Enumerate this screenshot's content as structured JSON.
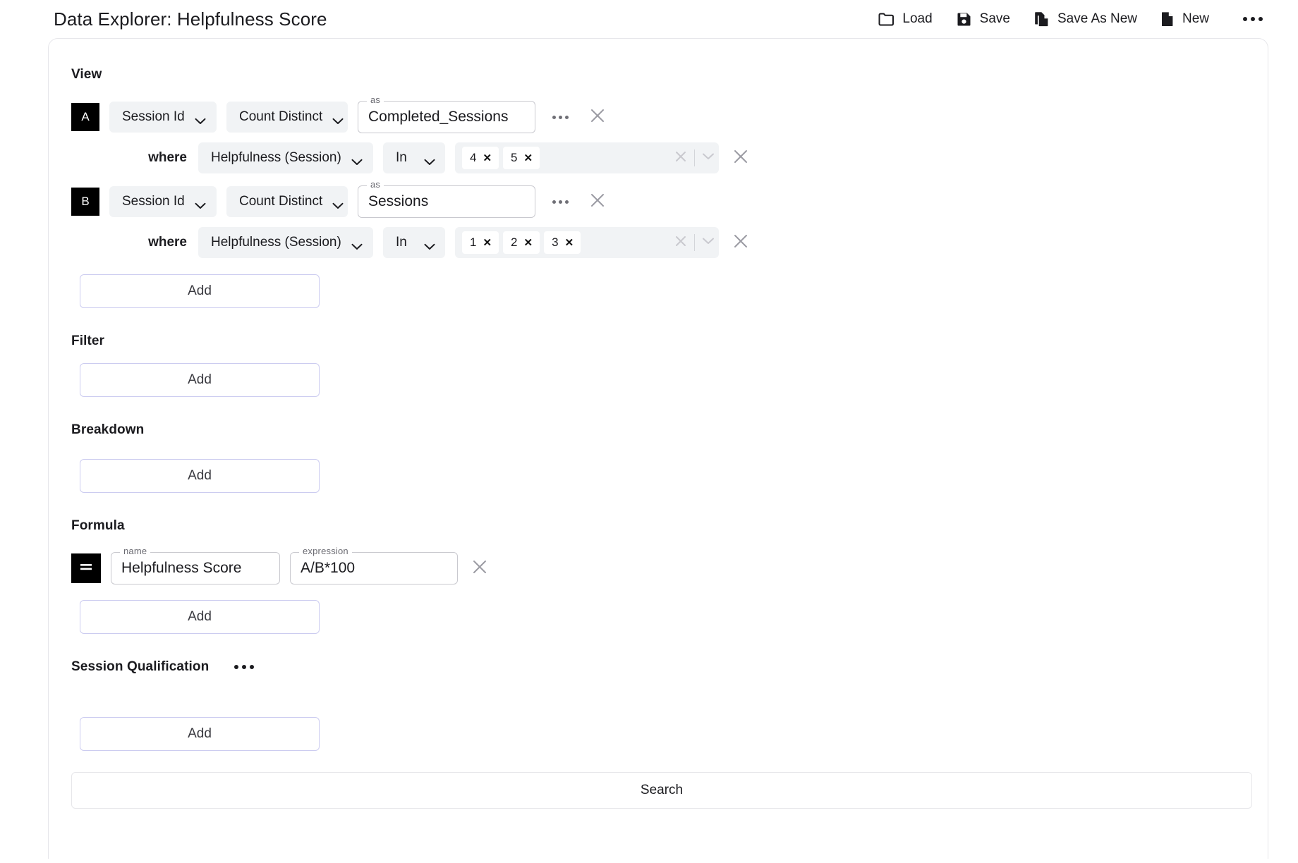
{
  "header": {
    "title": "Data Explorer: Helpfulness Score",
    "actions": [
      {
        "label": "Load",
        "icon": "folder-icon"
      },
      {
        "label": "Save",
        "icon": "floppy-disk-icon"
      },
      {
        "label": "Save As New",
        "icon": "copy-document-icon"
      },
      {
        "label": "New",
        "icon": "document-icon"
      }
    ],
    "overflow_icon": "kebab-menu-icon"
  },
  "sections": {
    "view": {
      "label": "View",
      "rows": [
        {
          "badge": "A",
          "dimension": "Session Id",
          "aggregation": "Count Distinct",
          "alias_legend": "as",
          "alias_value": "Completed_Sessions",
          "where": {
            "keyword": "where",
            "field": "Helpfulness (Session)",
            "operator": "In",
            "values": [
              "4",
              "5"
            ]
          }
        },
        {
          "badge": "B",
          "dimension": "Session Id",
          "aggregation": "Count Distinct",
          "alias_legend": "as",
          "alias_value": "Sessions",
          "where": {
            "keyword": "where",
            "field": "Helpfulness (Session)",
            "operator": "In",
            "values": [
              "1",
              "2",
              "3"
            ]
          }
        }
      ],
      "add_label": "Add"
    },
    "filter": {
      "label": "Filter",
      "add_label": "Add"
    },
    "breakdown": {
      "label": "Breakdown",
      "add_label": "Add"
    },
    "formula": {
      "label": "Formula",
      "badge": "=",
      "name_legend": "name",
      "name_value": "Helpfulness Score",
      "expression_legend": "expression",
      "expression_value": "A/B*100",
      "add_label": "Add"
    },
    "session_qualification": {
      "label": "Session Qualification",
      "overflow_icon": "kebab-menu-icon",
      "add_label": "Add"
    }
  },
  "footer": {
    "search_label": "Search"
  },
  "icons": {
    "chevron_down": "chevron-down-icon",
    "close": "close-icon",
    "clear": "clear-icon"
  },
  "colors": {
    "badge_bg": "#000000",
    "select_bg": "#f1f3f5",
    "add_border": "#ccccf0",
    "card_border": "#e6e6ea",
    "text": "#1b1b1f"
  }
}
